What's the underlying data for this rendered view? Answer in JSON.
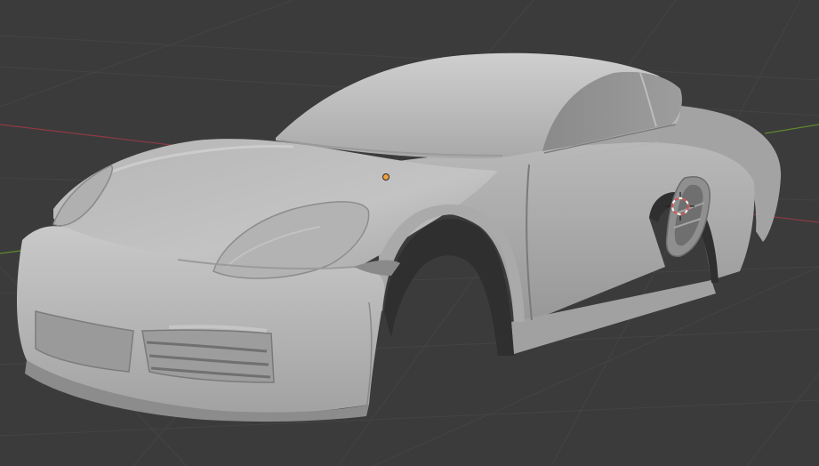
{
  "viewport": {
    "mode": "3d-viewport",
    "shading": "solid",
    "object": "car-body-mesh",
    "colors": {
      "background": "#3b3b3b",
      "grid_line": "#444444",
      "x_axis": "#8f3b44",
      "y_axis": "#5d8a2c",
      "mesh_light": "#c4c4c4",
      "mesh_mid": "#a8a8a8",
      "mesh_dark": "#6f6f6f",
      "glass": "#8e8e8e",
      "origin_dot": "#f2a03a",
      "cursor_red": "#d8554f",
      "cursor_white": "#f4f4f4"
    },
    "icons": [
      "object-origin-icon",
      "3d-cursor-icon"
    ]
  }
}
